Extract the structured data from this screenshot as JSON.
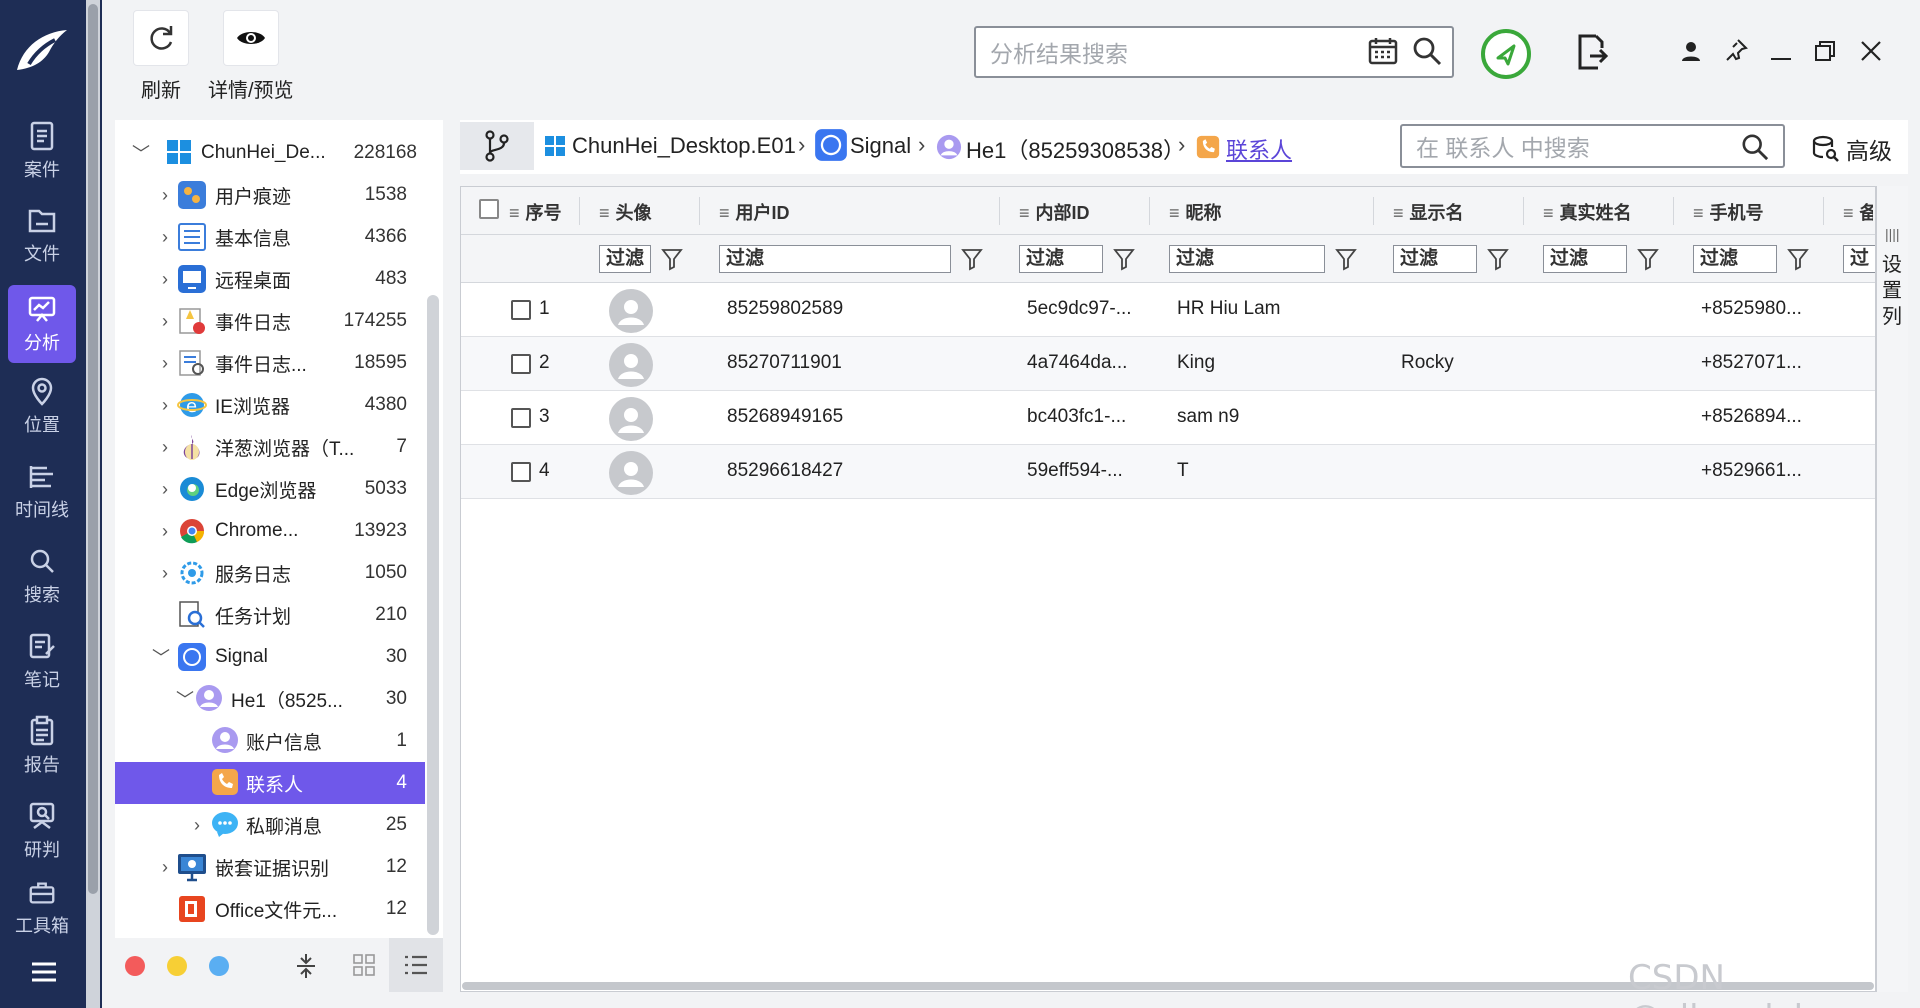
{
  "nav": {
    "items": [
      {
        "label": "案件",
        "icon": "case-icon"
      },
      {
        "label": "文件",
        "icon": "folder-icon"
      },
      {
        "label": "分析",
        "icon": "analysis-icon",
        "active": true
      },
      {
        "label": "位置",
        "icon": "location-icon"
      },
      {
        "label": "时间线",
        "icon": "timeline-icon"
      },
      {
        "label": "搜索",
        "icon": "search-icon"
      },
      {
        "label": "笔记",
        "icon": "notes-icon"
      },
      {
        "label": "报告",
        "icon": "report-icon"
      },
      {
        "label": "研判",
        "icon": "judge-icon"
      },
      {
        "label": "工具箱",
        "icon": "toolbox-icon"
      }
    ]
  },
  "toolbar": {
    "refresh_label": "刷新",
    "preview_label": "详情/预览"
  },
  "top_search": {
    "placeholder": "分析结果搜索"
  },
  "tree": {
    "root": {
      "label": "ChunHei_De...",
      "count": "228168"
    },
    "items": [
      {
        "label": "用户痕迹",
        "count": "1538"
      },
      {
        "label": "基本信息",
        "count": "4366"
      },
      {
        "label": "远程桌面",
        "count": "483"
      },
      {
        "label": "事件日志",
        "count": "174255"
      },
      {
        "label": "事件日志...",
        "count": "18595"
      },
      {
        "label": "IE浏览器",
        "count": "4380"
      },
      {
        "label": "洋葱浏览器（T...",
        "count": "7"
      },
      {
        "label": "Edge浏览器",
        "count": "5033"
      },
      {
        "label": "Chrome...",
        "count": "13923"
      },
      {
        "label": "服务日志",
        "count": "1050"
      },
      {
        "label": "任务计划",
        "count": "210"
      },
      {
        "label": "Signal",
        "count": "30"
      },
      {
        "label": "He1（8525...",
        "count": "30"
      },
      {
        "label": "账户信息",
        "count": "1"
      },
      {
        "label": "联系人",
        "count": "4"
      },
      {
        "label": "私聊消息",
        "count": "25"
      },
      {
        "label": "嵌套证据识别",
        "count": "12"
      },
      {
        "label": "Office文件元...",
        "count": "12"
      }
    ]
  },
  "breadcrumb": {
    "items": [
      "ChunHei_Desktop.E01",
      "Signal",
      "He1（85259308538）",
      "联系人"
    ]
  },
  "inner_search": {
    "placeholder": "在 联系人 中搜索"
  },
  "advanced_label": "高级",
  "grid": {
    "columns": [
      "序号",
      "头像",
      "用户ID",
      "内部ID",
      "昵称",
      "显示名",
      "真实姓名",
      "手机号",
      "备"
    ],
    "filter_label": "过滤",
    "filter_label_cut": "过滤",
    "rows": [
      {
        "index": "1",
        "user_id": "85259802589",
        "internal_id": "5ec9dc97-...",
        "nickname": "HR Hiu Lam",
        "display_name": "",
        "real_name": "",
        "phone": "+8525980..."
      },
      {
        "index": "2",
        "user_id": "85270711901",
        "internal_id": "4a7464da...",
        "nickname": "King",
        "display_name": "Rocky",
        "real_name": "",
        "phone": "+8527071..."
      },
      {
        "index": "3",
        "user_id": "85268949165",
        "internal_id": "bc403fc1-...",
        "nickname": "sam n9",
        "display_name": "",
        "real_name": "",
        "phone": "+8526894..."
      },
      {
        "index": "4",
        "user_id": "85296618427",
        "internal_id": "59eff594-...",
        "nickname": "T",
        "display_name": "",
        "real_name": "",
        "phone": "+8529661..."
      }
    ]
  },
  "settings_col": {
    "lines": "||||",
    "label_1": "设",
    "label_2": "置",
    "label_3": "列"
  },
  "watermark": "CSDN @sll_scdyh",
  "colors": {
    "accent": "#6f58ea",
    "nav_bg": "#1e2d55",
    "ok_green": "#3aa83a"
  }
}
